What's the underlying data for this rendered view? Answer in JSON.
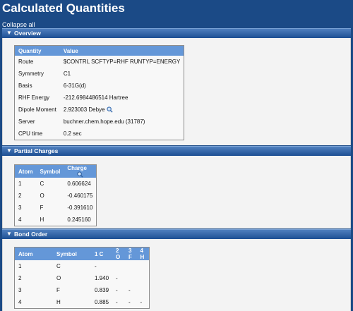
{
  "page": {
    "title": "Calculated Quantities",
    "collapse_all": "Collapse all"
  },
  "overview": {
    "header": "Overview",
    "columns": [
      "Quantity",
      "Value"
    ],
    "rows": [
      {
        "q": "Route",
        "v": "$CONTRL SCFTYP=RHF RUNTYP=ENERGY"
      },
      {
        "q": "Symmetry",
        "v": "C1"
      },
      {
        "q": "Basis",
        "v": "6-31G(d)"
      },
      {
        "q": "RHF Energy",
        "v": "-212.6984486514 Hartree"
      },
      {
        "q": "Dipole Moment",
        "v": "2.923003 Debye"
      },
      {
        "q": "Server",
        "v": "buchner.chem.hope.edu (31787)"
      },
      {
        "q": "CPU time",
        "v": "0.2 sec"
      }
    ]
  },
  "partial_charges": {
    "header": "Partial Charges",
    "columns": [
      "Atom",
      "Symbol",
      "Charge"
    ],
    "rows": [
      {
        "atom": "1",
        "symbol": "C",
        "charge": "0.606624"
      },
      {
        "atom": "2",
        "symbol": "O",
        "charge": "-0.460175"
      },
      {
        "atom": "3",
        "symbol": "F",
        "charge": "-0.391610"
      },
      {
        "atom": "4",
        "symbol": "H",
        "charge": "0.245160"
      }
    ]
  },
  "bond_order": {
    "header": "Bond Order",
    "columns": [
      "Atom",
      "Symbol",
      "1 C",
      "2 O",
      "3 F",
      "4 H"
    ],
    "rows": [
      {
        "atom": "1",
        "symbol": "C",
        "c1": "-",
        "c2": "",
        "c3": "",
        "c4": ""
      },
      {
        "atom": "2",
        "symbol": "O",
        "c1": "1.940",
        "c2": "-",
        "c3": "",
        "c4": ""
      },
      {
        "atom": "3",
        "symbol": "F",
        "c1": "0.839",
        "c2": "-",
        "c3": "-",
        "c4": ""
      },
      {
        "atom": "4",
        "symbol": "H",
        "c1": "0.885",
        "c2": "-",
        "c3": "-",
        "c4": "-"
      }
    ]
  },
  "icons": {
    "section_toggle": "chevron-down-icon",
    "zoom": "magnifier-icon"
  }
}
